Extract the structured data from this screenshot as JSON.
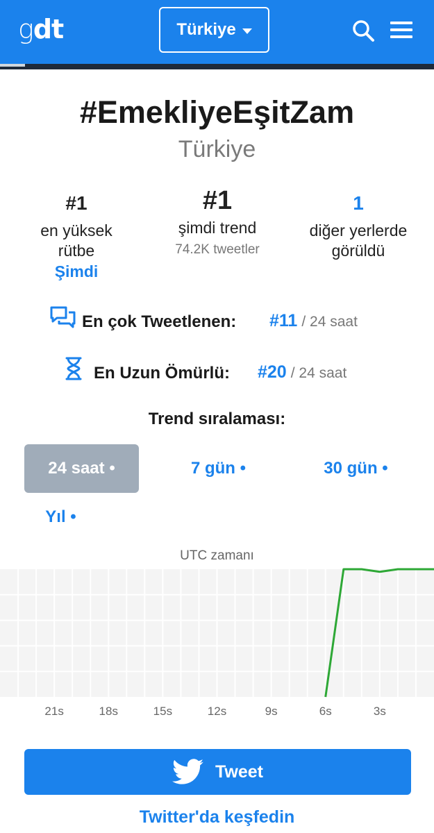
{
  "header": {
    "logo_light": "g",
    "logo_bold": "dt",
    "country": "Türkiye",
    "brand_color": "#1b82ec"
  },
  "trend": {
    "title": "#EmekliyeEşitZam",
    "location": "Türkiye"
  },
  "stats": {
    "highest": {
      "value": "#1",
      "label_line1": "en yüksek",
      "label_line2": "rütbe",
      "when": "Şimdi"
    },
    "current": {
      "value": "#1",
      "label": "şimdi trend",
      "sub": "74.2K tweetler"
    },
    "elsewhere": {
      "value": "1",
      "label_line1": "diğer yerlerde",
      "label_line2": "görüldü"
    }
  },
  "most_tweeted": {
    "icon": "chat-bubbles-icon",
    "label": "En çok Tweetlenen:",
    "rank": "#11",
    "period": "/ 24 saat"
  },
  "longest_lived": {
    "icon": "hourglass-icon",
    "label": "En Uzun Ömürlü:",
    "rank": "#20",
    "period": "/ 24 saat"
  },
  "ranking": {
    "title": "Trend sıralaması:",
    "tabs": [
      "24 saat •",
      "7 gün •",
      "30 gün •",
      "Yıl •"
    ],
    "active_tab": 0
  },
  "chart_data": {
    "type": "line",
    "title": "UTC zamanı",
    "xlabel": "",
    "ylabel": "",
    "x_tick_labels": [
      "21s",
      "18s",
      "15s",
      "12s",
      "9s",
      "6s",
      "3s"
    ],
    "x_tick_values": [
      -21,
      -18,
      -15,
      -12,
      -9,
      -6,
      -3
    ],
    "xlim": [
      -24,
      0
    ],
    "ylim": [
      50,
      1
    ],
    "grid": true,
    "series": [
      {
        "x": [
          -6,
          -5,
          -4,
          -3,
          -2,
          -1,
          0
        ],
        "values": [
          50,
          1,
          1,
          2,
          1,
          1,
          1
        ],
        "color": "#2ea836"
      }
    ]
  },
  "actions": {
    "tweet_label": "Tweet",
    "explore_label": "Twitter'da keşfedin"
  }
}
